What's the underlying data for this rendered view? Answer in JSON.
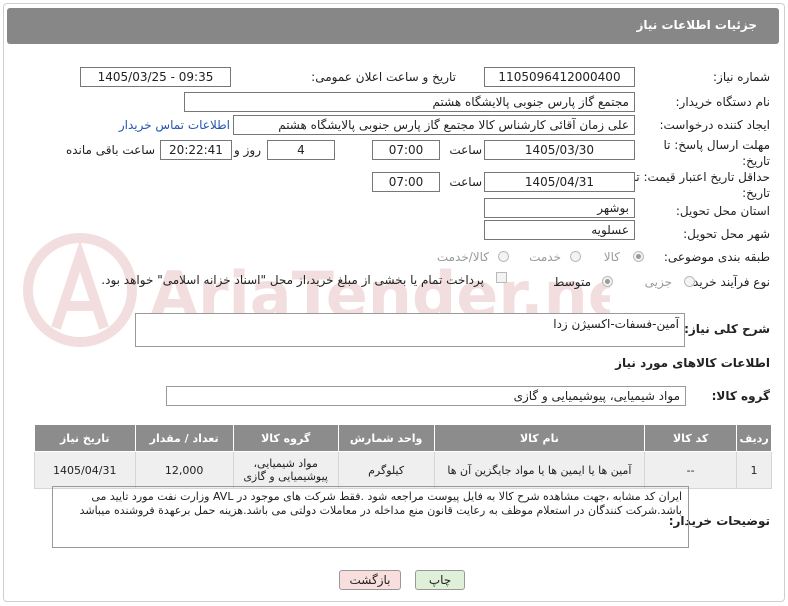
{
  "header": {
    "title": "جزئیات اطلاعات نیاز"
  },
  "need_number": {
    "label": "شماره نیاز:",
    "value": "1105096412000400"
  },
  "announce": {
    "label": "تاریخ و ساعت اعلان عمومی:",
    "value": "1405/03/25 - 09:35"
  },
  "buyer_org": {
    "label": "نام دستگاه خریدار:",
    "value": "مجتمع گاز پارس جنوبی  پالایشگاه هشتم"
  },
  "creator": {
    "label": "ایجاد کننده درخواست:",
    "value": "علی زمان آقائی کارشناس کالا مجتمع گاز پارس جنوبی  پالایشگاه هشتم",
    "contact_link": "اطلاعات تماس خریدار"
  },
  "deadline": {
    "label": "مهلت ارسال پاسخ: تا تاریخ:",
    "date": "1405/03/30",
    "time_label": "ساعت",
    "time": "07:00",
    "days": "4",
    "days_label": "روز و",
    "remaining": "20:22:41",
    "remaining_label": "ساعت باقی مانده"
  },
  "validity": {
    "label": "حداقل تاریخ اعتبار قیمت: تا تاریخ:",
    "date": "1405/04/31",
    "time_label": "ساعت",
    "time": "07:00"
  },
  "province": {
    "label": "استان محل تحویل:",
    "value": "بوشهر"
  },
  "city": {
    "label": "شهر محل تحویل:",
    "value": "عسلویه"
  },
  "category": {
    "label": "طبقه بندی موضوعی:",
    "options": [
      "کالا",
      "خدمت",
      "کالا/خدمت"
    ]
  },
  "process": {
    "label": "نوع فرآیند خرید :",
    "options": [
      "جزیی",
      "متوسط"
    ],
    "payment_note": "پرداخت تمام یا بخشی از مبلغ خرید،از محل \"اسناد خزانه اسلامی\" خواهد بود."
  },
  "description": {
    "label": "شرح کلی نیاز:",
    "value": "آمین-فسفات-اکسیژن زدا"
  },
  "goods_info": {
    "title": "اطلاعات کالاهای مورد نیاز"
  },
  "goods_group": {
    "label": "گروه کالا:",
    "value": "مواد شیمیایی، پیوشیمیایی و  گازی"
  },
  "table": {
    "headers": [
      "ردیف",
      "کد کالا",
      "نام کالا",
      "واحد شمارش",
      "گروه کالا",
      "تعداد / مقدار",
      "تاریخ نیاز"
    ],
    "rows": [
      [
        "1",
        "--",
        "آمین ها یا ایمین ها یا مواد جایگزین آن ها",
        "کیلوگرم",
        "مواد شیمیایی، پیوشیمیایی و گازی",
        "12,000",
        "1405/04/31"
      ]
    ]
  },
  "buyer_notes": {
    "label": "توضیحات خریدار:",
    "value": "ایران کد مشابه ،جهت مشاهده شرح کالا به فایل پیوست مراجعه شود .فقط شرکت های موجود در AVL وزارت نفت مورد تایید می باشد.شرکت کنندگان در استعلام موظف به رعایت قانون منع مداخله در معاملات دولتی می باشد.هزینه حمل برعهدة فروشنده میباشد"
  },
  "buttons": {
    "print": "چاپ",
    "back": "بازگشت"
  },
  "watermark": {
    "text": "AriaTender.net"
  },
  "colors": {
    "header_bg": "#878787",
    "table_header_bg": "#8c8c8c",
    "back_button_bg": "#f9dede",
    "print_button_bg": "#dff0d8",
    "link": "#2456b0",
    "watermark": "#b33a3a"
  }
}
